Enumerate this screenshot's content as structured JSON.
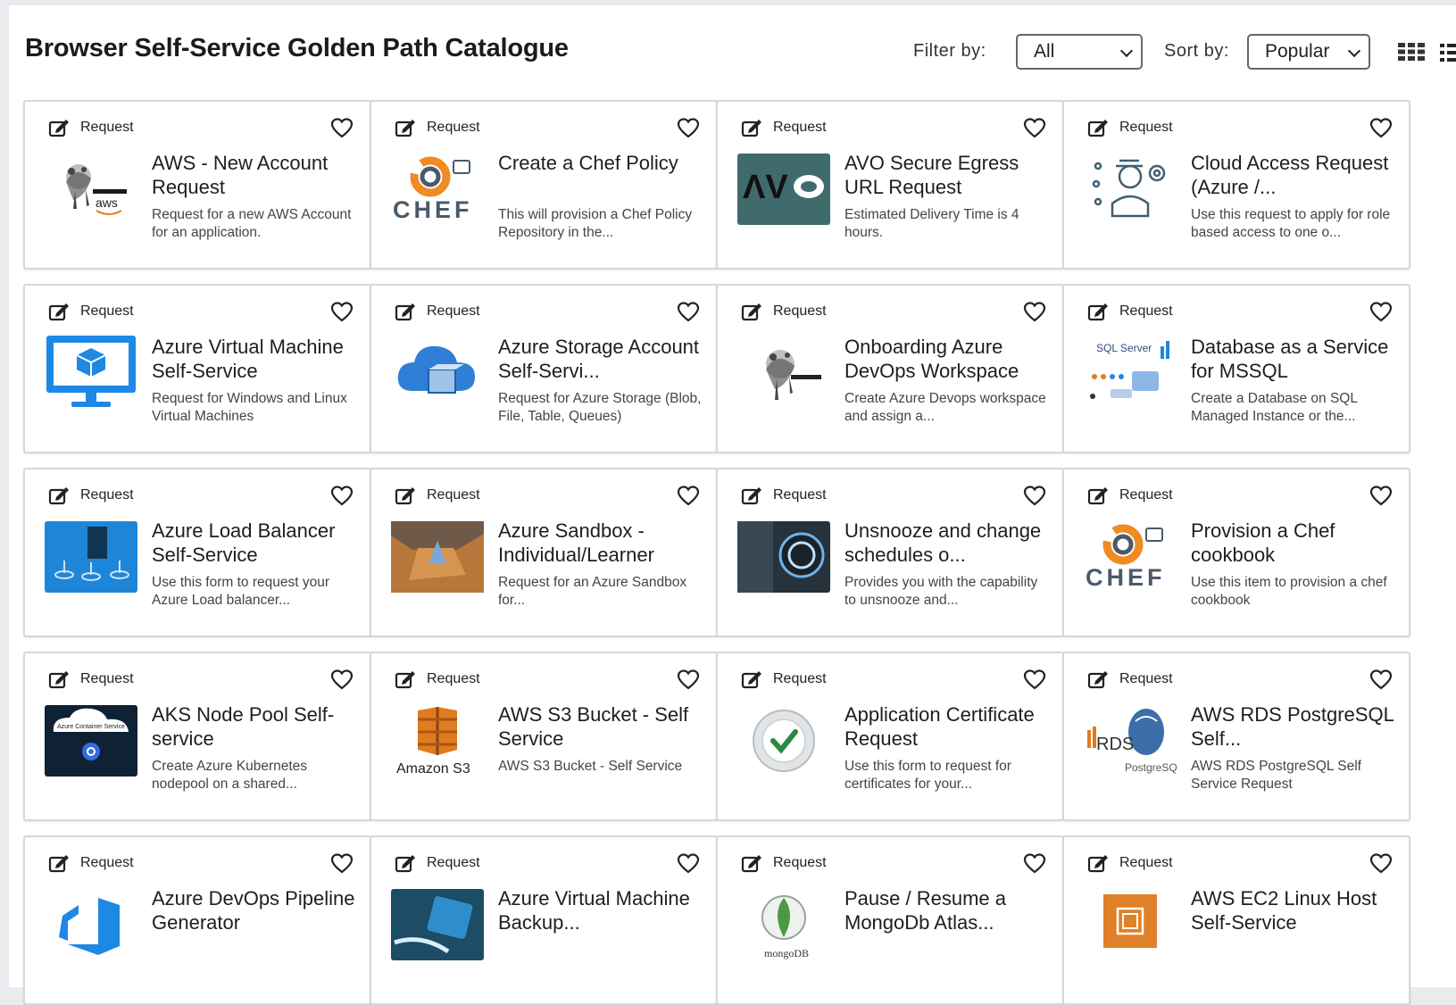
{
  "page": {
    "title": "Browser Self-Service Golden Path Catalogue",
    "filter_label": "Filter by:",
    "filter_value": "All",
    "sort_label": "Sort by:",
    "sort_value": "Popular"
  },
  "colors": {
    "card_border": "#d5d7da",
    "azure_blue": "#1e88e5",
    "chef_orange": "#f08a24",
    "avo_teal": "#3c6e6e",
    "aws_orange": "#e07b1f"
  },
  "cards": [
    {
      "badge": "Request",
      "name": "AWS - New Account Request",
      "desc": "Request for a new AWS Account for an application.",
      "icon": "aws-redwan-logo-icon"
    },
    {
      "badge": "Request",
      "name": "Create a Chef Policy",
      "desc": "This will provision a Chef Policy Repository in the...",
      "icon": "chef-logo-icon"
    },
    {
      "badge": "Request",
      "name": "AVO Secure Egress URL Request",
      "desc": "Estimated Delivery Time is 4 hours.",
      "icon": "avo-logo-icon"
    },
    {
      "badge": "Request",
      "name": "Cloud Access Request (Azure /...",
      "desc": "Use this request to apply for role based access to one o...",
      "icon": "cloud-access-user-icon"
    },
    {
      "badge": "Request",
      "name": "Azure Virtual Machine Self-Service",
      "desc": "Request for Windows and Linux Virtual Machines",
      "icon": "azure-vm-monitor-icon"
    },
    {
      "badge": "Request",
      "name": "Azure Storage Account Self-Servi...",
      "desc": "Request for Azure Storage (Blob, File, Table, Queues)",
      "icon": "azure-storage-cloud-icon"
    },
    {
      "badge": "Request",
      "name": "Onboarding Azure DevOps Workspace",
      "desc": "Create Azure Devops workspace and assign a...",
      "icon": "redwan-logo-icon"
    },
    {
      "badge": "Request",
      "name": "Database as a Service for MSSQL",
      "desc": "Create a Database on SQL Managed Instance or the...",
      "icon": "sql-server-icon"
    },
    {
      "badge": "Request",
      "name": "Azure Load Balancer Self-Service",
      "desc": "Use this form to request your Azure Load balancer...",
      "icon": "load-balancer-icon"
    },
    {
      "badge": "Request",
      "name": "Azure Sandbox - Individual/Learner",
      "desc": "Request for an Azure Sandbox for...",
      "icon": "sandbox-box-icon"
    },
    {
      "badge": "Request",
      "name": "Unsnooze and change schedules o...",
      "desc": "Provides you with the capability to unsnooze and...",
      "icon": "power-button-icon"
    },
    {
      "badge": "Request",
      "name": "Provision a Chef cookbook",
      "desc": "Use this item to provision a chef cookbook",
      "icon": "chef-logo-icon"
    },
    {
      "badge": "Request",
      "name": "AKS Node Pool Self-service",
      "desc": "Create Azure Kubernetes nodepool on a shared...",
      "icon": "kubernetes-icon",
      "thumb_text": "Azure Container Service"
    },
    {
      "badge": "Request",
      "name": "AWS S3 Bucket - Self Service",
      "desc": "AWS S3 Bucket - Self Service",
      "icon": "amazon-s3-icon",
      "thumb_text": "Amazon S3"
    },
    {
      "badge": "Request",
      "name": "Application Certificate Request",
      "desc": "Use this form to request for certificates for your...",
      "icon": "ssl-certificate-icon"
    },
    {
      "badge": "Request",
      "name": "AWS RDS PostgreSQL Self...",
      "desc": "AWS RDS PostgreSQL Self Service Request",
      "icon": "rds-postgresql-icon",
      "thumb_text": "PostgreSQL"
    },
    {
      "badge": "Request",
      "name": "Azure DevOps Pipeline Generator",
      "desc": "",
      "icon": "azure-devops-icon"
    },
    {
      "badge": "Request",
      "name": "Azure Virtual Machine Backup...",
      "desc": "",
      "icon": "vm-backup-icon"
    },
    {
      "badge": "Request",
      "name": "Pause / Resume a MongoDb Atlas...",
      "desc": "",
      "icon": "mongodb-icon",
      "thumb_text": "mongoDB"
    },
    {
      "badge": "Request",
      "name": "AWS EC2 Linux Host Self-Service",
      "desc": "",
      "icon": "aws-ec2-icon"
    }
  ]
}
